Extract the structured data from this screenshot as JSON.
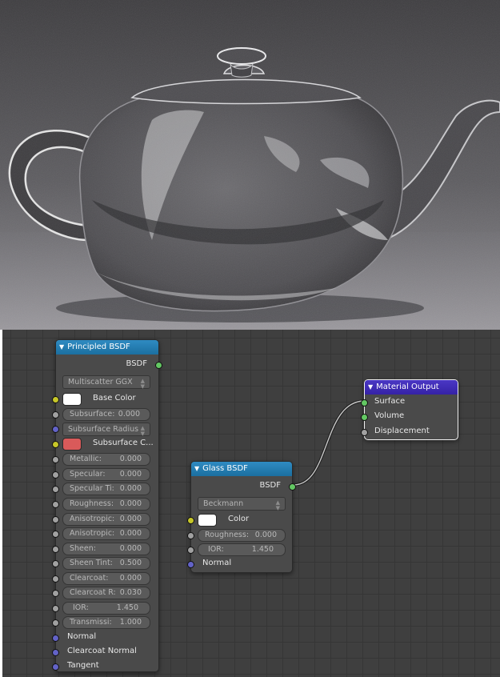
{
  "colors": {
    "base_color_swatch": "#ffffff",
    "subsurface_color_swatch": "#d95a5a",
    "glass_color_swatch": "#ffffff",
    "shader_header": "#1b6fa0",
    "output_header": "#3522a6",
    "socket_shader": "#63c763",
    "socket_color": "#c7c729",
    "socket_float": "#a1a1a1",
    "socket_vector": "#6363c7",
    "editor_background": "#3f3f3f"
  },
  "principled": {
    "title": "Principled BSDF",
    "output_label": "BSDF",
    "distribution": "Multiscatter GGX",
    "base_color_label": "Base Color",
    "subsurface": {
      "label": "Subsurface:",
      "value": "0.000"
    },
    "subsurface_radius": "Subsurface Radius",
    "subsurface_color_label": "Subsurface C...",
    "metallic": {
      "label": "Metallic:",
      "value": "0.000"
    },
    "specular": {
      "label": "Specular:",
      "value": "0.000"
    },
    "specular_tint": {
      "label": "Specular Ti:",
      "value": "0.000"
    },
    "roughness": {
      "label": "Roughness:",
      "value": "0.000"
    },
    "anisotropic": {
      "label": "Anisotropic:",
      "value": "0.000"
    },
    "anisotropic_rotation": {
      "label": "Anisotropic:",
      "value": "0.000"
    },
    "sheen": {
      "label": "Sheen:",
      "value": "0.000"
    },
    "sheen_tint": {
      "label": "Sheen Tint:",
      "value": "0.500"
    },
    "clearcoat": {
      "label": "Clearcoat:",
      "value": "0.000"
    },
    "clearcoat_roughness": {
      "label": "Clearcoat R:",
      "value": "0.030"
    },
    "ior": {
      "label": "IOR:",
      "value": "1.450"
    },
    "transmission": {
      "label": "Transmissi:",
      "value": "1.000"
    },
    "normal": "Normal",
    "clearcoat_normal": "Clearcoat Normal",
    "tangent": "Tangent"
  },
  "glass": {
    "title": "Glass BSDF",
    "output_label": "BSDF",
    "distribution": "Beckmann",
    "color_label": "Color",
    "roughness": {
      "label": "Roughness:",
      "value": "0.000"
    },
    "ior": {
      "label": "IOR:",
      "value": "1.450"
    },
    "normal": "Normal"
  },
  "output": {
    "title": "Material Output",
    "surface": "Surface",
    "volume": "Volume",
    "displacement": "Displacement"
  }
}
